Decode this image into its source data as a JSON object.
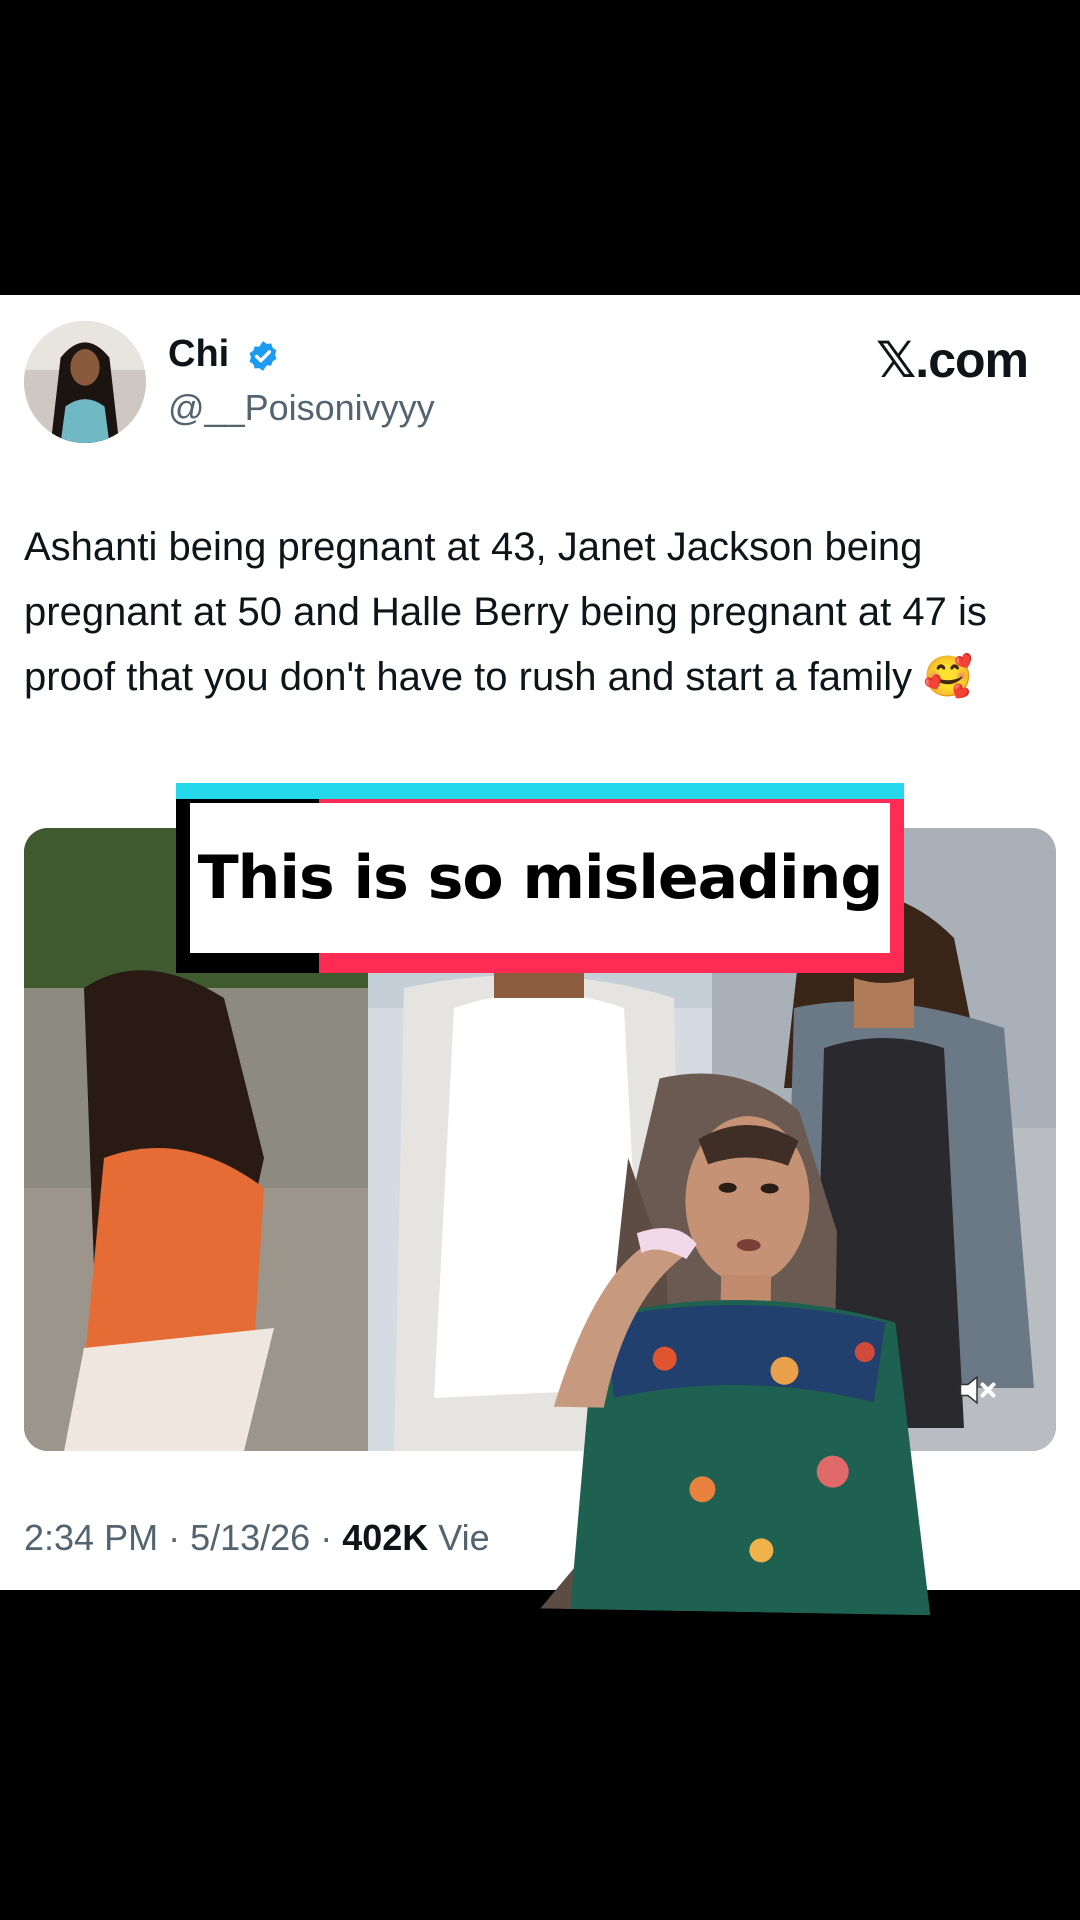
{
  "tweet": {
    "display_name": "Chi",
    "handle": "@__Poisonivyyy",
    "brand": "𝕏.com",
    "text": "Ashanti being pregnant at 43, Janet Jackson being pregnant at 50 and Halle Berry being pregnant at 47 is proof that you don't have to rush and start a family 🥰",
    "time": "2:34 PM",
    "date": "5/13/26",
    "views_count": "402K",
    "views_label": "Vie",
    "separator": " · "
  },
  "caption": {
    "text": "This is so misleading"
  },
  "colors": {
    "accent_cyan": "#25d8ec",
    "accent_magenta": "#fe2c55",
    "verified_blue": "#1d9bf0",
    "text_primary": "#0f1419",
    "text_secondary": "#536471"
  },
  "icons": {
    "verified": "verified-badge-icon",
    "mute": "speaker-muted-icon"
  }
}
